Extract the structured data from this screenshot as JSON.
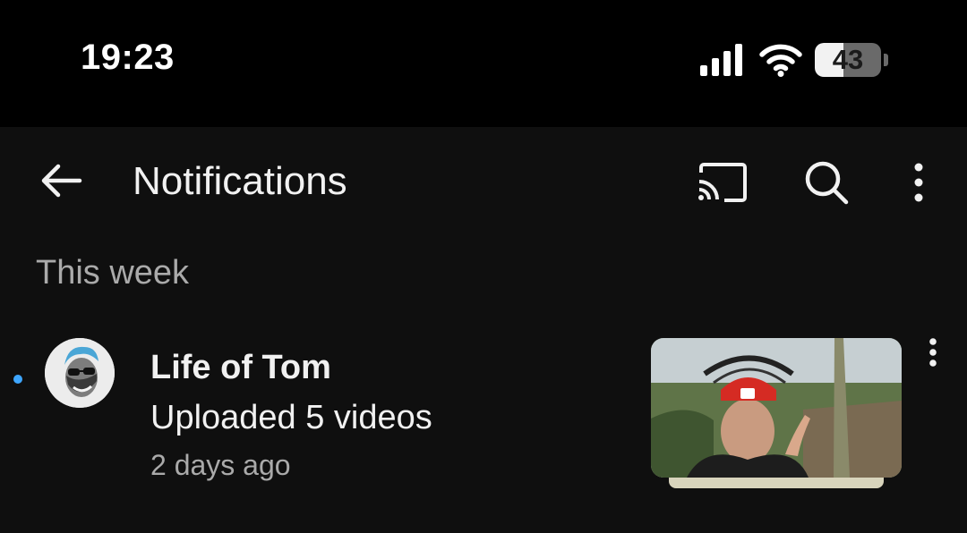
{
  "status_bar": {
    "time": "19:23",
    "battery_percent": "43",
    "battery_level": 0.43,
    "icons": [
      "signal-icon",
      "wifi-icon",
      "battery-icon"
    ]
  },
  "app_bar": {
    "title": "Notifications",
    "actions": [
      "back-arrow-icon",
      "cast-icon",
      "search-icon",
      "more-vertical-icon"
    ]
  },
  "section": {
    "heading": "This week"
  },
  "notifications": [
    {
      "channel": "Life of Tom",
      "text": "Uploaded 5 videos",
      "time": "2 days ago",
      "unread": true
    }
  ],
  "colors": {
    "background": "#0f0f0f",
    "status_bar": "#000000",
    "primary_text": "#f1f1f1",
    "secondary_text": "#aaaaaa",
    "unread_dot": "#3ea6ff"
  }
}
